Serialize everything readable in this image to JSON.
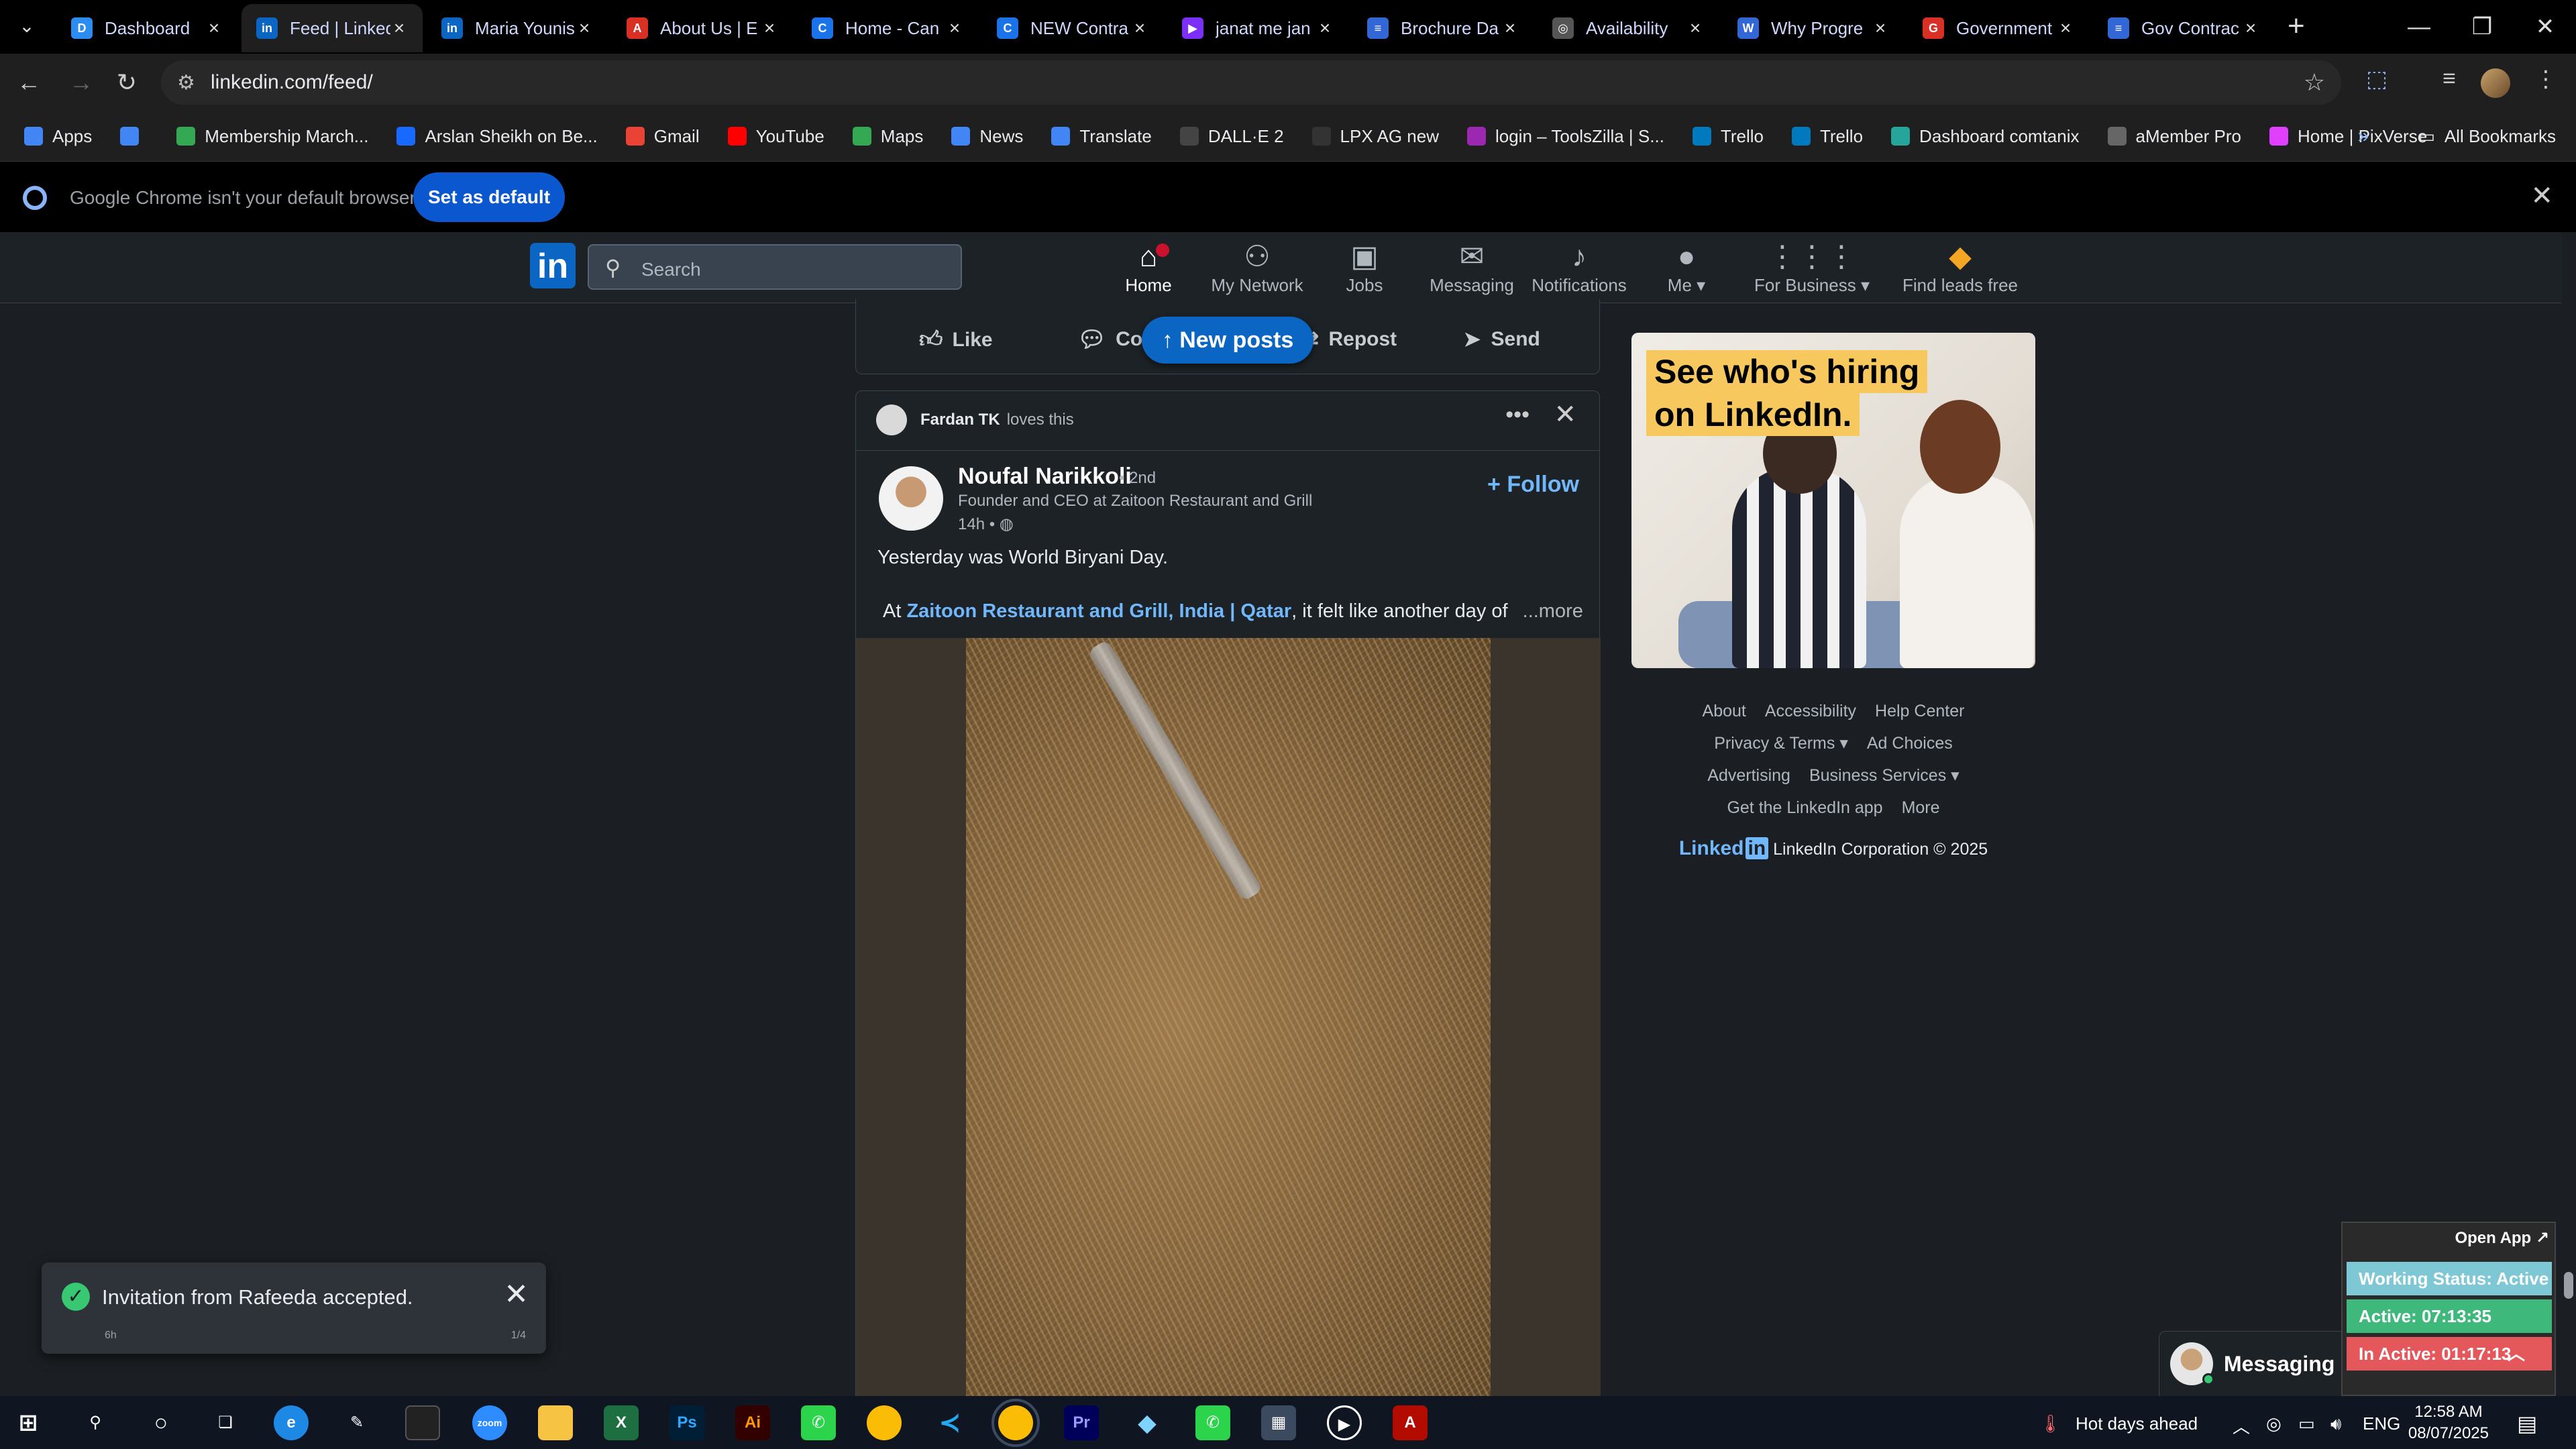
{
  "tabs": [
    {
      "title": "Dashboard",
      "color": "#2d8cf0",
      "glyph": "D"
    },
    {
      "title": "Feed | LinkedIn",
      "color": "#0a66c2",
      "glyph": "in"
    },
    {
      "title": "Maria Younis",
      "color": "#0a66c2",
      "glyph": "in"
    },
    {
      "title": "About Us | E",
      "color": "#d93025",
      "glyph": "A"
    },
    {
      "title": "Home - Can",
      "color": "#1a73e8",
      "glyph": "C"
    },
    {
      "title": "NEW Contra",
      "color": "#1a73e8",
      "glyph": "C"
    },
    {
      "title": "janat me jan",
      "color": "#7b2ff7",
      "glyph": "▶"
    },
    {
      "title": "Brochure Da",
      "color": "#3367d6",
      "glyph": "≡"
    },
    {
      "title": "Availability",
      "color": "#555555",
      "glyph": "◎"
    },
    {
      "title": "Why Progre",
      "color": "#3367d6",
      "glyph": "W"
    },
    {
      "title": "Government",
      "color": "#d93025",
      "glyph": "G"
    },
    {
      "title": "Gov Contrac",
      "color": "#3367d6",
      "glyph": "≡"
    }
  ],
  "address": {
    "url": "linkedin.com/feed/"
  },
  "bookmarks": [
    {
      "label": "Apps",
      "color": "#4285f4"
    },
    {
      "label": "",
      "color": "#4285f4"
    },
    {
      "label": "Membership March...",
      "color": "#34a853"
    },
    {
      "label": "Arslan Sheikh on Be...",
      "color": "#1769ff"
    },
    {
      "label": "Gmail",
      "color": "#ea4335"
    },
    {
      "label": "YouTube",
      "color": "#ff0000"
    },
    {
      "label": "Maps",
      "color": "#34a853"
    },
    {
      "label": "News",
      "color": "#4285f4"
    },
    {
      "label": "Translate",
      "color": "#4285f4"
    },
    {
      "label": "DALL·E 2",
      "color": "#444444"
    },
    {
      "label": "LPX AG new",
      "color": "#333333"
    },
    {
      "label": "login – ToolsZilla | S...",
      "color": "#9c27b0"
    },
    {
      "label": "Trello",
      "color": "#0079bf"
    },
    {
      "label": "Trello",
      "color": "#0079bf"
    },
    {
      "label": "Dashboard comtanix",
      "color": "#26a69a"
    },
    {
      "label": "aMember Pro",
      "color": "#666666"
    },
    {
      "label": "Home | PixVerse",
      "color": "#e040fb"
    }
  ],
  "bookmarks_all": "All Bookmarks",
  "infobar": {
    "message": "Google Chrome isn't your default browser",
    "button": "Set as default"
  },
  "linkedin": {
    "search_placeholder": "Search",
    "nav": [
      {
        "label": "Home",
        "icon": "home-icon",
        "glyph": "⌂"
      },
      {
        "label": "My Network",
        "icon": "network-icon",
        "glyph": "⚇"
      },
      {
        "label": "Jobs",
        "icon": "briefcase-icon",
        "glyph": "▣"
      },
      {
        "label": "Messaging",
        "icon": "messaging-icon",
        "glyph": "✉"
      },
      {
        "label": "Notifications",
        "icon": "bell-icon",
        "glyph": "♪"
      },
      {
        "label": "Me ▾",
        "icon": "avatar-icon",
        "glyph": "●"
      },
      {
        "label": "For Business ▾",
        "icon": "grid-icon",
        "glyph": "⋮⋮⋮"
      },
      {
        "label": "Find leads free",
        "icon": "leads-icon",
        "glyph": "◆"
      }
    ],
    "actions": {
      "like": "Like",
      "comment": "Comment",
      "repost": "Repost",
      "send": "Send"
    },
    "new_posts": "↑ New posts",
    "post": {
      "loved_by": "Fardan TK",
      "loved_text": "loves this",
      "author": "Noufal Narikkoli",
      "degree": "• 2nd",
      "headline": "Founder and CEO at Zaitoon Restaurant and Grill",
      "time": "14h •",
      "follow": "+ Follow",
      "line1": "Yesterday was World Biryani Day.",
      "line2_prefix": "At",
      "line2_link": "Zaitoon Restaurant and Grill, India | Qatar",
      "line2_rest": ", it felt like another day of",
      "more": "...more"
    },
    "ad": {
      "line1": "See who's hiring",
      "line2": "on LinkedIn."
    },
    "footer": {
      "row1": [
        "About",
        "Accessibility",
        "Help Center"
      ],
      "row2": [
        "Privacy & Terms ▾",
        "Ad Choices"
      ],
      "row3": [
        "Advertising",
        "Business Services ▾"
      ],
      "row4": [
        "Get the LinkedIn app",
        "More"
      ],
      "copyright": "LinkedIn Corporation © 2025"
    },
    "toast": {
      "message": "Invitation from Rafeeda accepted.",
      "left": "6h",
      "right": "1/4"
    },
    "messaging": "Messaging"
  },
  "tracker": {
    "open": "Open App ↗",
    "working": "Working Status: Active",
    "active": "Active: 07:13:35",
    "inactive": "In Active: 01:17:13"
  },
  "taskbar": {
    "weather": "Hot days ahead",
    "lang": "ENG",
    "time": "12:58 AM",
    "date": "08/07/2025"
  }
}
